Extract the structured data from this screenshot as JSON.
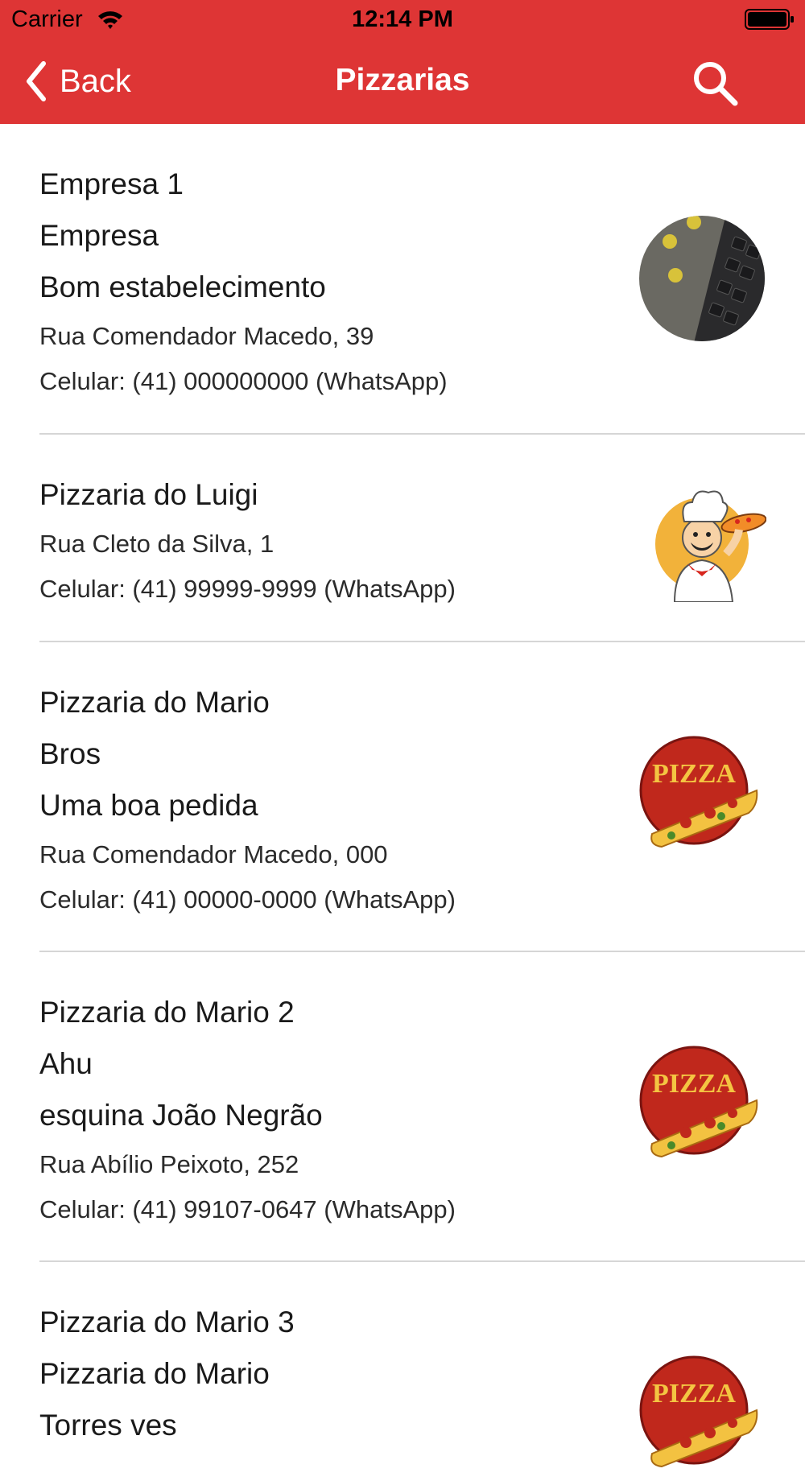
{
  "status_bar": {
    "carrier": "Carrier",
    "time": "12:14 PM"
  },
  "nav": {
    "back_label": "Back",
    "title": "Pizzarias",
    "icon_back": "chevron-left-icon",
    "icon_search": "search-icon"
  },
  "colors": {
    "bar": "#de3535",
    "text": "#1a1a1a",
    "separator": "#d6d6d6"
  },
  "items": [
    {
      "name": "Empresa 1",
      "subtitle": "Empresa",
      "description": "Bom estabelecimento",
      "address": "Rua Comendador Macedo, 39",
      "phone": "Celular: (41) 000000000 (WhatsApp)",
      "image": "laptop-keyboard-photo"
    },
    {
      "name": "Pizzaria do Luigi",
      "address": "Rua Cleto da Silva, 1",
      "phone": "Celular: (41) 99999-9999 (WhatsApp)",
      "image": "chef-cartoon-logo"
    },
    {
      "name": "Pizzaria do Mario",
      "subtitle": "Bros",
      "description": "Uma boa pedida",
      "address": "Rua Comendador Macedo, 000",
      "phone": "Celular: (41) 00000-0000 (WhatsApp)",
      "image": "pizza-logo",
      "logo_text": "PIZZA"
    },
    {
      "name": "Pizzaria do Mario 2",
      "subtitle": "Ahu",
      "description": "esquina João Negrão",
      "address": "Rua Abílio Peixoto, 252",
      "phone": "Celular: (41) 99107-0647 (WhatsApp)",
      "image": "pizza-logo",
      "logo_text": "PIZZA"
    },
    {
      "name": "Pizzaria do Mario 3",
      "subtitle": "Pizzaria do Mario",
      "description": "Torres ves",
      "image": "pizza-logo",
      "logo_text": "PIZZA"
    }
  ]
}
